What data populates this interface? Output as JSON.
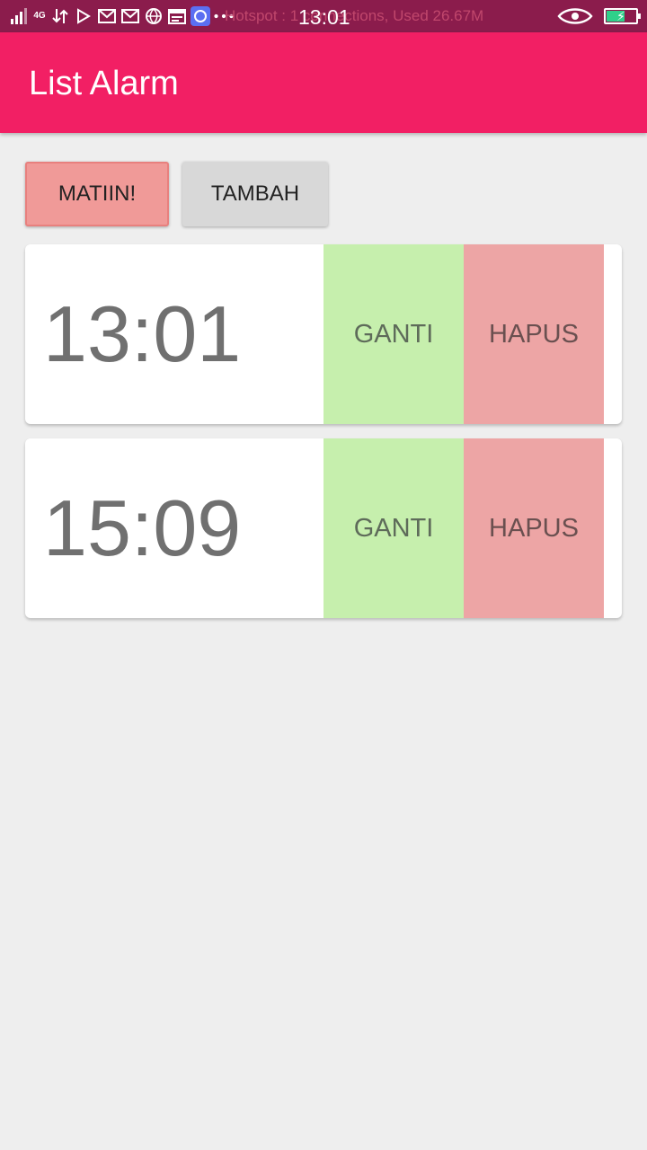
{
  "status_bar": {
    "network_label": "4G",
    "notification_text": "Hotspot : 1 connections, Used 26.67M",
    "time": "13:01",
    "icons": [
      "signal-icon",
      "network-4g-icon",
      "transfer-icon",
      "play-store-icon",
      "mail-icon",
      "mail-icon",
      "globe-icon",
      "calendar-icon",
      "app-icon",
      "more-dots-icon",
      "eye-icon",
      "battery-icon"
    ],
    "battery_color": "#2fd08a"
  },
  "app_bar": {
    "title": "List Alarm",
    "color": "#f21f64"
  },
  "actions": {
    "matiin_label": "MATIIN!",
    "tambah_label": "TAMBAH"
  },
  "alarms": [
    {
      "time": "13:01",
      "edit_label": "GANTI",
      "delete_label": "HAPUS"
    },
    {
      "time": "15:09",
      "edit_label": "GANTI",
      "delete_label": "HAPUS"
    }
  ],
  "colors": {
    "ganti": "#c6efad",
    "hapus": "#eda5a5",
    "matiin": "#f09a98"
  }
}
